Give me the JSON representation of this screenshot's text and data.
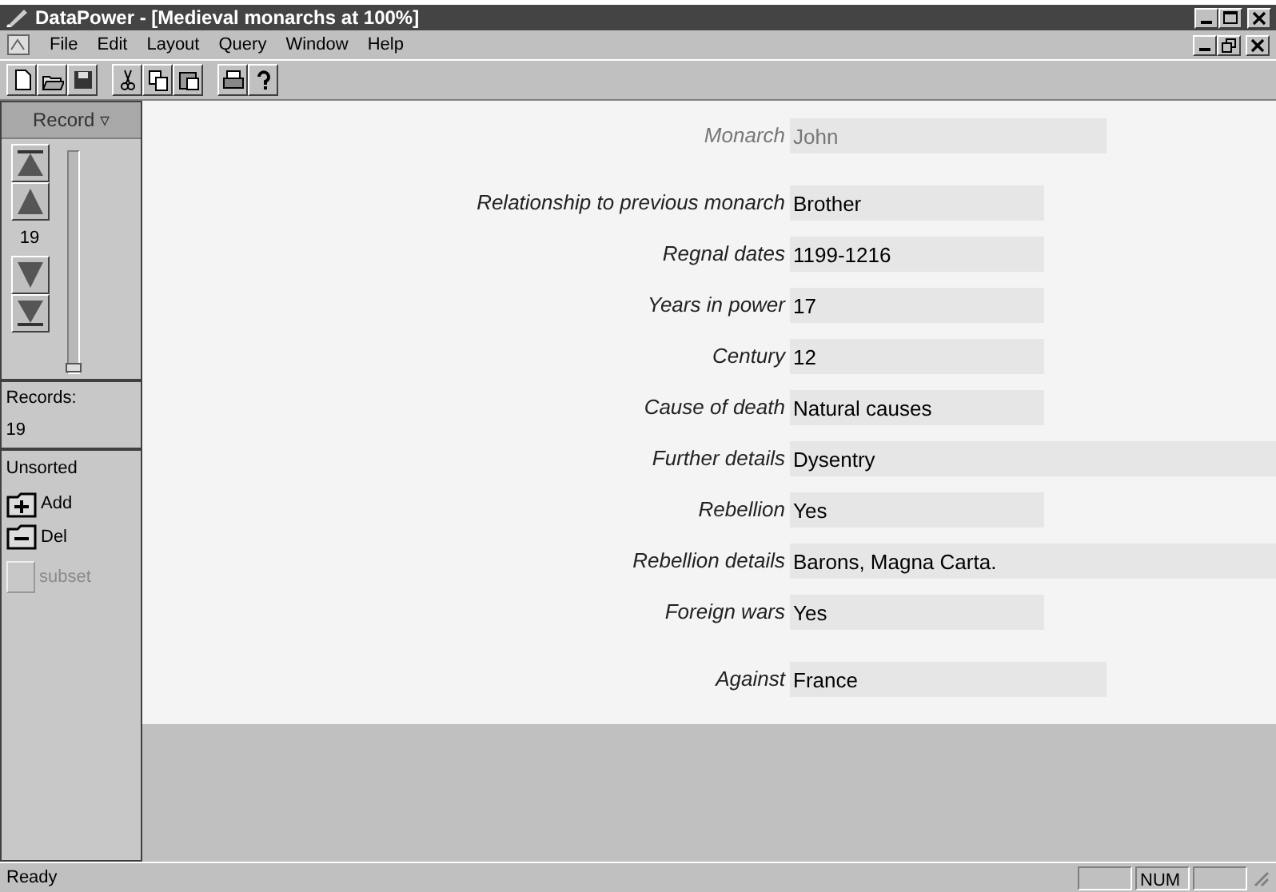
{
  "window": {
    "title": "DataPower - [Medieval monarchs at 100%]"
  },
  "menu": [
    "File",
    "Edit",
    "Layout",
    "Query",
    "Window",
    "Help"
  ],
  "navigator": {
    "title": "Record ▿",
    "record_number": "19",
    "records_label": "Records:",
    "records_count": "19",
    "sort": "Unsorted",
    "add": "Add",
    "del": "Del",
    "subset": {
      "label": "subset",
      "disabled": true
    }
  },
  "sections": [
    [
      {
        "label": "Monarch",
        "value": "John",
        "kind": "medium",
        "disabled": true
      }
    ],
    [
      {
        "label": "Relationship to previous monarch",
        "value": "Brother",
        "kind": "short",
        "disabled": false
      },
      {
        "label": "Regnal dates",
        "value": "1199-1216",
        "kind": "short",
        "disabled": false
      },
      {
        "label": "Years in power",
        "value": "17",
        "kind": "short",
        "disabled": false
      },
      {
        "label": "Century",
        "value": "12",
        "kind": "short",
        "disabled": false
      },
      {
        "label": "Cause of death",
        "value": "Natural causes",
        "kind": "short",
        "disabled": false
      },
      {
        "label": "Further details",
        "value": "Dysentry",
        "kind": "full",
        "disabled": false
      },
      {
        "label": "Rebellion",
        "value": "Yes",
        "kind": "short",
        "disabled": false
      },
      {
        "label": "Rebellion details",
        "value": "Barons, Magna Carta.",
        "kind": "full",
        "disabled": false
      },
      {
        "label": "Foreign wars",
        "value": "Yes",
        "kind": "short",
        "disabled": false
      }
    ],
    [
      {
        "label": "Against",
        "value": "France",
        "kind": "medium",
        "disabled": false
      }
    ]
  ],
  "status_bar": {
    "text": "Ready",
    "indicator": "NUM"
  }
}
